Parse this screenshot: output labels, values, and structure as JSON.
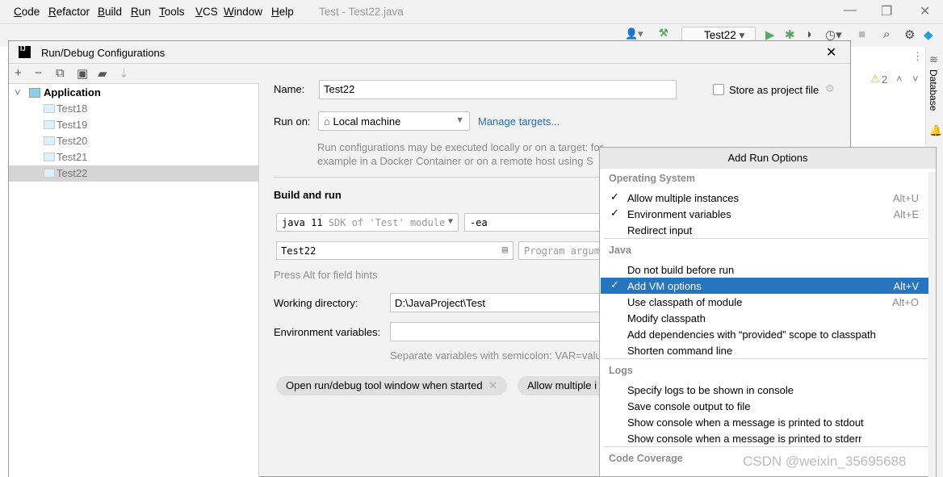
{
  "menubar": {
    "items": [
      "Code",
      "Refactor",
      "Build",
      "Run",
      "Tools",
      "VCS",
      "Window",
      "Help"
    ],
    "window_title": "Test - Test22.java"
  },
  "toolbar": {
    "run_config": "Test22"
  },
  "side": {
    "problems_count": "2",
    "database_label": "Database"
  },
  "dialog": {
    "title": "Run/Debug Configurations",
    "tree": {
      "group": "Application",
      "items": [
        "Test18",
        "Test19",
        "Test20",
        "Test21",
        "Test22"
      ],
      "selected": "Test22"
    },
    "name_label": "Name:",
    "name_value": "Test22",
    "store_label": "Store as project file",
    "run_on_label": "Run on:",
    "run_on_value": "Local machine",
    "manage_targets": "Manage targets...",
    "run_on_hint_1": "Run configurations may be executed locally or on a target: for",
    "run_on_hint_2": "example in a Docker Container or on a remote host using S",
    "build_run_heading": "Build and run",
    "sdk_main": "java 11",
    "sdk_detail": "SDK of 'Test' module",
    "vm_options": "-ea",
    "main_class": "Test22",
    "program_args_placeholder": "Program argume",
    "alt_hint": "Press Alt for field hints",
    "working_dir_label": "Working directory:",
    "working_dir_value": "D:\\JavaProject\\Test",
    "env_label": "Environment variables:",
    "env_value": "",
    "env_hint": "Separate variables with semicolon: VAR=valu",
    "chips": [
      "Open run/debug tool window when started",
      "Allow multiple i"
    ]
  },
  "popup": {
    "title": "Add Run Options",
    "sections": [
      {
        "header": "Operating System",
        "items": [
          {
            "label": "Allow multiple instances",
            "checked": true,
            "shortcut": "Alt+U"
          },
          {
            "label": "Environment variables",
            "checked": true,
            "shortcut": "Alt+E"
          },
          {
            "label": "Redirect input",
            "checked": false,
            "shortcut": ""
          }
        ]
      },
      {
        "header": "Java",
        "items": [
          {
            "label": "Do not build before run",
            "checked": false,
            "shortcut": ""
          },
          {
            "label": "Add VM options",
            "checked": true,
            "shortcut": "Alt+V",
            "selected": true
          },
          {
            "label": "Use classpath of module",
            "checked": false,
            "shortcut": "Alt+O"
          },
          {
            "label": "Modify classpath",
            "checked": false,
            "shortcut": ""
          },
          {
            "label": "Add dependencies with “provided” scope to classpath",
            "checked": false,
            "shortcut": ""
          },
          {
            "label": "Shorten command line",
            "checked": false,
            "shortcut": ""
          }
        ]
      },
      {
        "header": "Logs",
        "items": [
          {
            "label": "Specify logs to be shown in console",
            "checked": false,
            "shortcut": ""
          },
          {
            "label": "Save console output to file",
            "checked": false,
            "shortcut": ""
          },
          {
            "label": "Show console when a message is printed to stdout",
            "checked": false,
            "shortcut": ""
          },
          {
            "label": "Show console when a message is printed to stderr",
            "checked": false,
            "shortcut": ""
          }
        ]
      },
      {
        "header": "Code Coverage",
        "items": []
      }
    ]
  },
  "watermark": "CSDN @weixin_35695688",
  "colors": {
    "accent": "#2675bf",
    "link": "#2470b3",
    "run_green": "#59a869"
  }
}
